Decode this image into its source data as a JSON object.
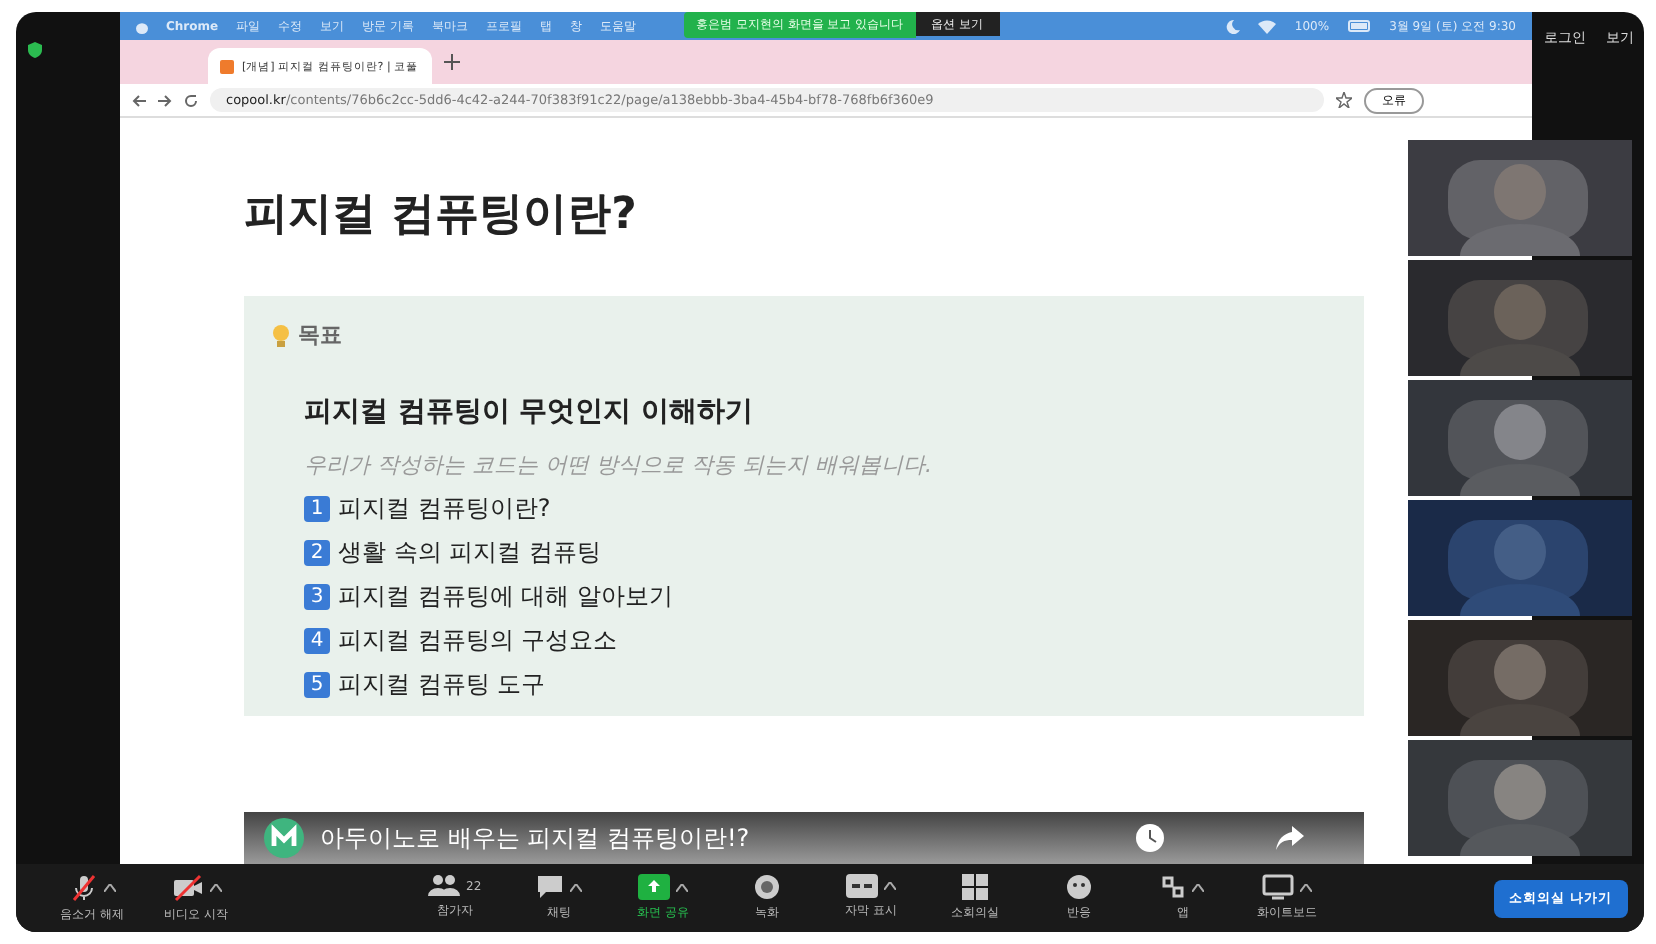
{
  "zoom_top": {
    "buttons": [
      "로그인",
      "보기"
    ]
  },
  "menu_bar": {
    "app": "Chrome",
    "items": [
      "파일",
      "수정",
      "보기",
      "방문 기록",
      "북마크",
      "프로필",
      "탭",
      "창",
      "도움말"
    ],
    "battery": "100%",
    "clock": "3월 9일 (토) 오전 9:30"
  },
  "share_banner": {
    "text": "홍은범 모지현의 화면을 보고 있습니다",
    "button": "옵션 보기"
  },
  "browser": {
    "tab": {
      "title": "[개념] 피지컬 컴퓨팅이란? | 코풀"
    },
    "url_host": "copool.kr",
    "url_path": "/contents/76b6c2cc-5dd6-4c42-a244-70f383f91c22/page/a138ebbb-3ba4-45b4-bf78-768fb6f360e9",
    "profile_button": "오류"
  },
  "page": {
    "title": "피지컬 컴퓨팅이란?",
    "callout": {
      "label": "목표",
      "heading": "피지컬 컴퓨팅이 무엇인지 이해하기",
      "subtitle": "우리가 작성하는 코드는 어떤 방식으로 작동 되는지 배워봅니다.",
      "items": [
        {
          "number": "1",
          "text": "피지컬 컴퓨팅이란?"
        },
        {
          "number": "2",
          "text": "생활 속의 피지컬 컴퓨팅"
        },
        {
          "number": "3",
          "text": "피지컬 컴퓨팅에 대해 알아보기"
        },
        {
          "number": "4",
          "text": "피지컬 컴퓨팅의 구성요소"
        },
        {
          "number": "5",
          "text": "피지컬 컴퓨팅 도구"
        }
      ]
    },
    "video": {
      "title": "아두이노로 배우는 피지컬 컴퓨팅이란!?"
    }
  },
  "toolbar": {
    "left": [
      {
        "kind": "mic",
        "label": "음소거 해제"
      },
      {
        "kind": "video",
        "label": "비디오 시작"
      }
    ],
    "center": [
      {
        "kind": "participants",
        "label": "참가자",
        "count": "22"
      },
      {
        "kind": "chat",
        "label": "채팅"
      },
      {
        "kind": "share",
        "label": "화면 공유"
      },
      {
        "kind": "record",
        "label": "녹화"
      },
      {
        "kind": "cc",
        "label": "자막 표시"
      },
      {
        "kind": "rooms",
        "label": "소회의실"
      },
      {
        "kind": "reactions",
        "label": "반응"
      },
      {
        "kind": "apps",
        "label": "앱"
      },
      {
        "kind": "whiteboard",
        "label": "화이트보드"
      }
    ],
    "leave_button": "소회의실 나가기"
  }
}
